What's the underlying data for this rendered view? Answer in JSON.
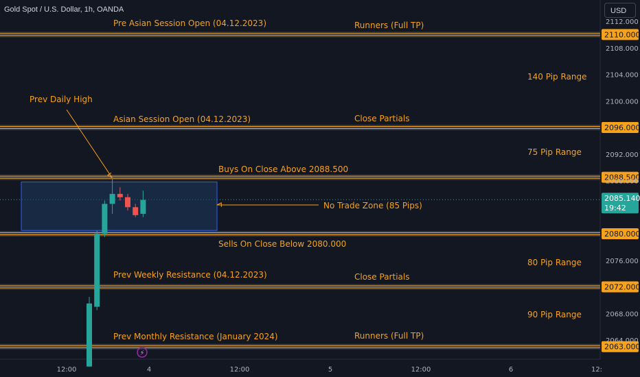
{
  "header": {
    "symbol_title": "Gold Spot / U.S. Dollar, 1h, OANDA",
    "currency_label": "USD"
  },
  "colors": {
    "background": "#131722",
    "level_line": "#f7a21b",
    "level_band": "#3a3d48",
    "annotation_text": "#f7a21b",
    "candle_up": "#26a69a",
    "candle_down": "#ef5350",
    "zone_fill": "#1e3a5f",
    "zone_border": "#2962ff",
    "current_price_bg": "#26a69a",
    "axis_text": "#b2b5be"
  },
  "chart_data": {
    "type": "candlestick",
    "title": "Gold Spot / U.S. Dollar, 1h, OANDA",
    "ylim": [
      2062.0,
      2113.5
    ],
    "price_ticks": [
      2112.0,
      2108.0,
      2104.0,
      2100.0,
      2092.0,
      2088.0,
      2076.0,
      2068.0,
      2064.0
    ],
    "time_ticks": [
      "12:00",
      "4",
      "12:00",
      "5",
      "12:00",
      "6",
      "12:"
    ],
    "current_price": "2085.140",
    "countdown": "19:42",
    "levels": [
      {
        "price": 2110.0,
        "label": "2110.000"
      },
      {
        "price": 2096.0,
        "label": "2096.000"
      },
      {
        "price": 2088.5,
        "label": "2088.500"
      },
      {
        "price": 2080.0,
        "label": "2080.000"
      },
      {
        "price": 2072.0,
        "label": "2072.000"
      },
      {
        "price": 2063.0,
        "label": "2063.000"
      }
    ],
    "candles": [
      {
        "o": 2060.0,
        "h": 2070.5,
        "l": 2060.0,
        "c": 2069.5
      },
      {
        "o": 2069.0,
        "h": 2080.5,
        "l": 2068.5,
        "c": 2080.0
      },
      {
        "o": 2080.0,
        "h": 2085.0,
        "l": 2079.5,
        "c": 2084.5
      },
      {
        "o": 2084.5,
        "h": 2088.5,
        "l": 2083.0,
        "c": 2086.0
      },
      {
        "o": 2086.0,
        "h": 2087.0,
        "l": 2085.0,
        "c": 2085.5
      },
      {
        "o": 2085.5,
        "h": 2086.0,
        "l": 2083.5,
        "c": 2084.0
      },
      {
        "o": 2084.0,
        "h": 2084.5,
        "l": 2082.5,
        "c": 2082.8
      },
      {
        "o": 2083.0,
        "h": 2086.5,
        "l": 2082.5,
        "c": 2085.1
      }
    ],
    "zone": {
      "top": 2087.8,
      "bottom": 2080.5,
      "label": "No Trade Zone (85 Pips)"
    },
    "annotations": [
      {
        "key": "pre_asian",
        "text": "Pre Asian Session Open (04.12.2023)"
      },
      {
        "key": "runners_top",
        "text": "Runners (Full TP)"
      },
      {
        "key": "range_140",
        "text": "140 Pip Range"
      },
      {
        "key": "prev_daily_high",
        "text": "Prev Daily High"
      },
      {
        "key": "asian_open",
        "text": "Asian Session Open (04.12.2023)"
      },
      {
        "key": "close_partials_top",
        "text": "Close Partials"
      },
      {
        "key": "range_75",
        "text": "75 Pip Range"
      },
      {
        "key": "buys_above",
        "text": "Buys On Close Above 2088.500"
      },
      {
        "key": "no_trade_zone",
        "text": "No Trade Zone (85 Pips)"
      },
      {
        "key": "sells_below",
        "text": "Sells On Close Below 2080.000"
      },
      {
        "key": "range_80",
        "text": "80 Pip Range"
      },
      {
        "key": "prev_weekly_res",
        "text": "Prev Weekly Resistance (04.12.2023)"
      },
      {
        "key": "close_partials_bottom",
        "text": "Close Partials"
      },
      {
        "key": "range_90",
        "text": "90 Pip Range"
      },
      {
        "key": "prev_monthly_res",
        "text": "Prev Monthly Resistance (January 2024)"
      },
      {
        "key": "runners_bottom",
        "text": "Runners (Full TP)"
      }
    ]
  }
}
